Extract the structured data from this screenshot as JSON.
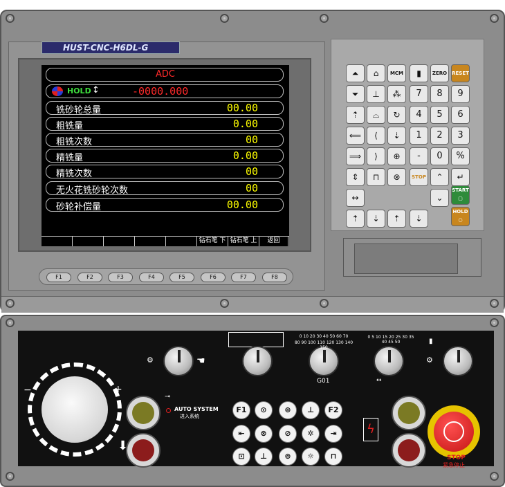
{
  "brand": {
    "label": "HUST-CNC-H6DL-G"
  },
  "screen": {
    "title": "ADC",
    "status": "HOLD",
    "position": "-0000.000",
    "rows": [
      {
        "label": "铣砂轮总量",
        "value": "00.00"
      },
      {
        "label": "粗铣量",
        "value": "0.00"
      },
      {
        "label": "粗铣次数",
        "value": "00"
      },
      {
        "label": "精铣量",
        "value": "0.00"
      },
      {
        "label": "精铣次数",
        "value": "00"
      },
      {
        "label": "无火花铣砂轮次数",
        "value": "00"
      },
      {
        "label": "砂轮补偿量",
        "value": "00.00"
      }
    ],
    "softkeys": [
      "",
      "",
      "",
      "",
      "",
      "钻石笔 下",
      "钻石笔 上",
      "返回"
    ]
  },
  "fkeys": [
    "F1",
    "F2",
    "F3",
    "F4",
    "F5",
    "F6",
    "F7",
    "F8"
  ],
  "keypad": {
    "mcm": "MCM",
    "zero": "ZERO",
    "reset": "RESET",
    "digits": [
      "7",
      "8",
      "9",
      "4",
      "5",
      "6",
      "1",
      "2",
      "3",
      "-",
      "0",
      "%"
    ],
    "stop": "STOP",
    "start": "START",
    "hold": "HOLD"
  },
  "operator": {
    "auto_system": "AUTO SYSTEM",
    "auto_system_cn": "进入系统",
    "g01": "G01",
    "stop": "STOP",
    "stop_cn": "紧急停止",
    "f1": "F1",
    "f2": "F2",
    "feed_scale": [
      "0",
      "10",
      "20",
      "30",
      "40",
      "50",
      "60",
      "70",
      "80",
      "90",
      "100",
      "110",
      "120",
      "130",
      "140",
      "150"
    ],
    "spindle_scale": [
      "0",
      "5",
      "10",
      "15",
      "20",
      "25",
      "30",
      "35",
      "40",
      "45",
      "50"
    ]
  },
  "colors": {
    "screen_bg": "#000000",
    "value": "#ffff00",
    "title": "#ff2a2a",
    "reset": "#c8861e",
    "start": "#2e8b3a",
    "hold": "#c8861e",
    "estop": "#e02020"
  }
}
